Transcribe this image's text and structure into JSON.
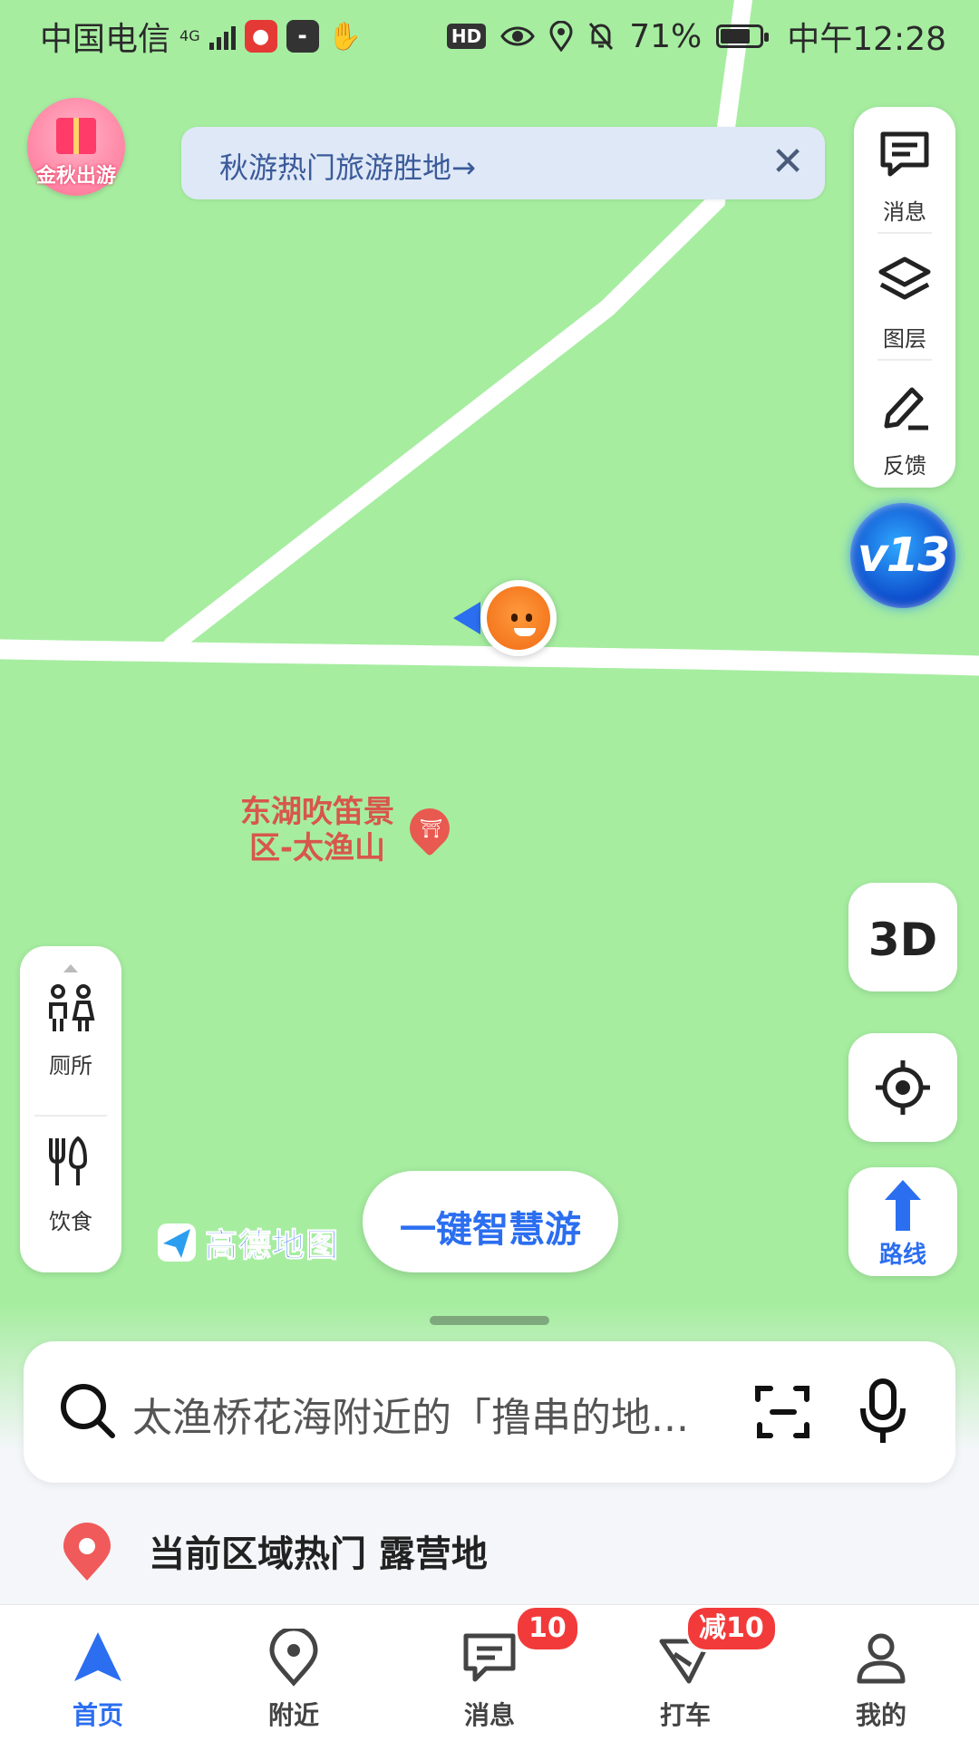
{
  "status_bar": {
    "carrier": "中国电信",
    "network": "4G",
    "hd": "HD",
    "battery": "71%",
    "time": "中午12:28"
  },
  "promo": {
    "gift_label": "金秋出游"
  },
  "banner": {
    "text": "秋游热门旅游胜地→",
    "close_symbol": "✕"
  },
  "right_tools": [
    {
      "label": "消息",
      "icon": "message-icon"
    },
    {
      "label": "图层",
      "icon": "layers-icon"
    },
    {
      "label": "反馈",
      "icon": "feedback-icon"
    }
  ],
  "version_badge": "v13",
  "poi": {
    "name_line1": "东湖吹笛景",
    "name_line2": "区-太渔山",
    "icon": "landmark-pin-icon"
  },
  "quick_panel": [
    {
      "label": "厕所",
      "icon": "restroom-icon"
    },
    {
      "label": "饮食",
      "icon": "food-icon"
    }
  ],
  "map_controls": {
    "three_d": "3D",
    "route": "路线"
  },
  "brand": "高德地图",
  "smart_tour": "一键智慧游",
  "search": {
    "placeholder": "太渔桥花海附近的「撸串的地..."
  },
  "hot_area": {
    "text": "当前区域热门 露营地"
  },
  "tabs": [
    {
      "label": "首页",
      "icon": "navigate-arrow-icon",
      "active": true
    },
    {
      "label": "附近",
      "icon": "location-pin-icon"
    },
    {
      "label": "消息",
      "icon": "message-icon",
      "badge": "10"
    },
    {
      "label": "打车",
      "icon": "taxi-icon",
      "badge": "减10"
    },
    {
      "label": "我的",
      "icon": "profile-icon"
    }
  ],
  "colors": {
    "map_bg": "#a6eda0",
    "road": "#ffffff",
    "accent": "#2b6ef0",
    "badge": "#f23a3a"
  }
}
